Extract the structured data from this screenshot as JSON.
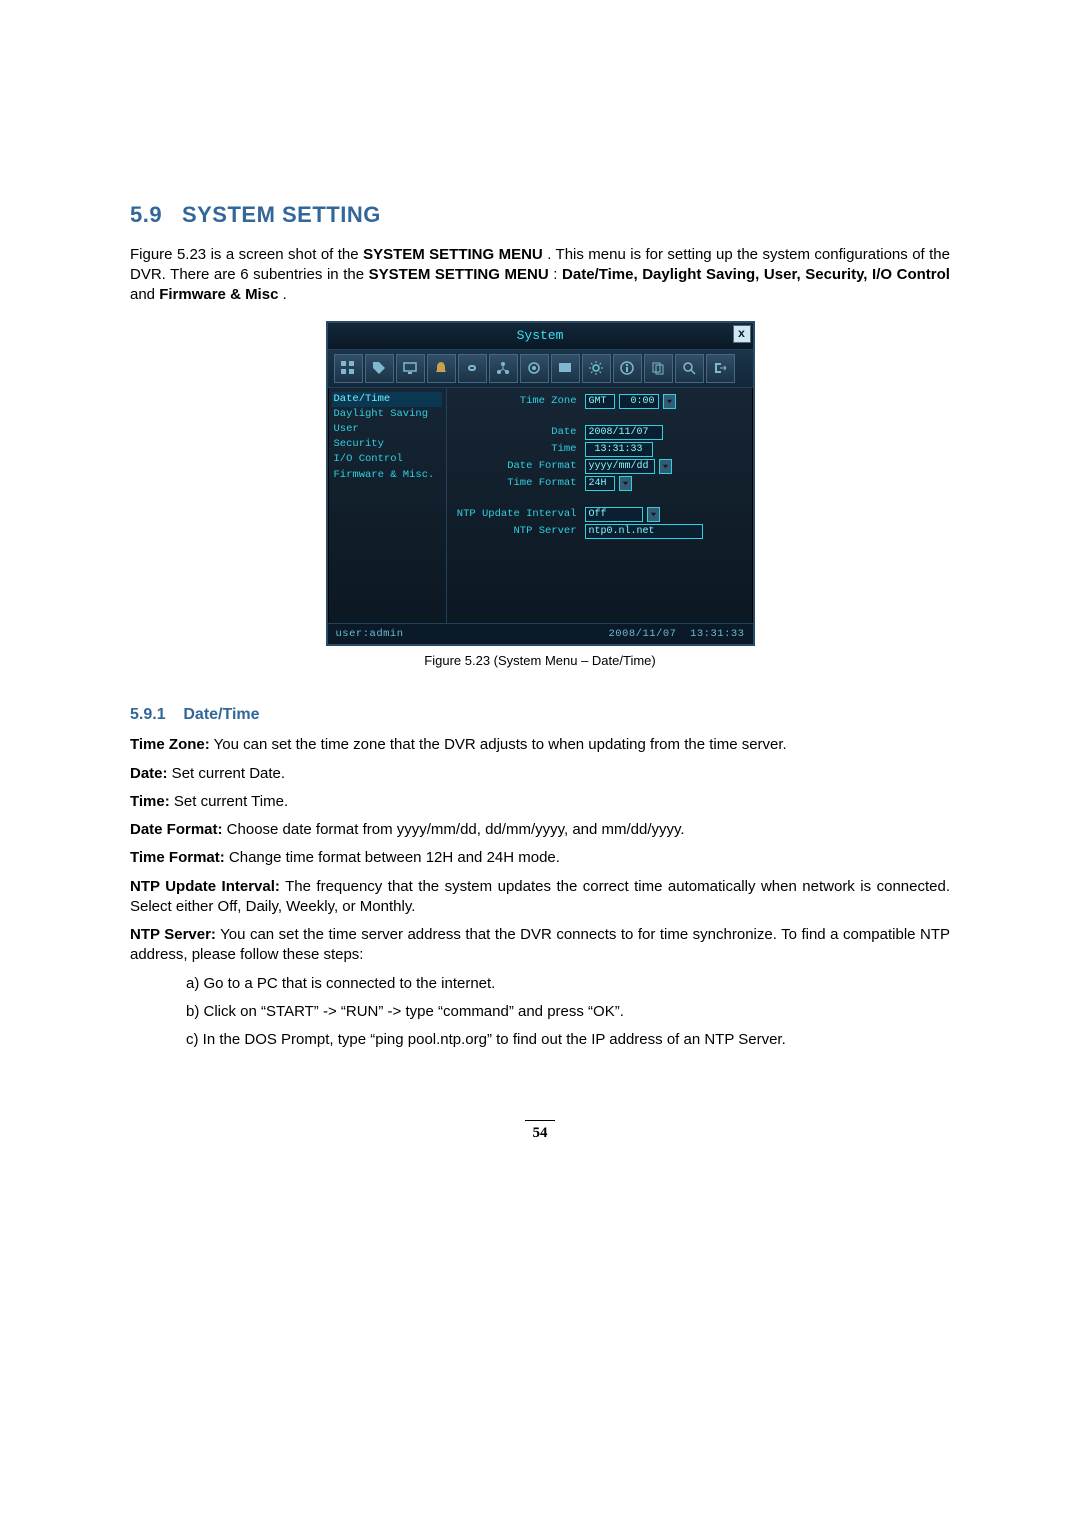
{
  "section": {
    "number": "5.9",
    "title": "SYSTEM SETTING",
    "intro_pre": "Figure 5.23 is a screen shot of the ",
    "intro_bold1": "SYSTEM SETTING MENU",
    "intro_mid1": ". This menu is for setting up the system configurations of the DVR. There are 6 subentries in the ",
    "intro_bold2": "SYSTEM SETTING MENU",
    "intro_mid2": ": ",
    "intro_bold3": "Date/Time, Daylight Saving, User, Security, I/O Control",
    "intro_mid3": " and ",
    "intro_bold4": "Firmware & Misc",
    "intro_end": "."
  },
  "figure": {
    "caption": "Figure 5.23 (System Menu – Date/Time)"
  },
  "ui": {
    "title": "System",
    "close": "x",
    "icons": [
      "grid-icon",
      "tag-icon",
      "monitor-icon",
      "bell-icon",
      "link-icon",
      "network-icon",
      "camera-icon",
      "screen-icon",
      "settings-icon",
      "info-icon",
      "copy-icon",
      "search-icon",
      "exit-icon"
    ],
    "sidebar": [
      {
        "label": "Date/Time",
        "active": true
      },
      {
        "label": "Daylight Saving"
      },
      {
        "label": "User"
      },
      {
        "label": "Security"
      },
      {
        "label": "I/O Control"
      },
      {
        "label": "Firmware & Misc."
      }
    ],
    "fields": {
      "timezone_label": "Time Zone",
      "timezone_a": "GMT",
      "timezone_b": "0:00",
      "date_label": "Date",
      "date_val": "2008/11/07",
      "time_label": "Time",
      "time_val": "13:31:33",
      "dateformat_label": "Date Format",
      "dateformat_val": "yyyy/mm/dd",
      "timeformat_label": "Time Format",
      "timeformat_val": "24H",
      "ntpint_label": "NTP Update Interval",
      "ntpint_val": "Off",
      "ntpserver_label": "NTP Server",
      "ntpserver_val": "ntp0.nl.net"
    },
    "status_user_label": "user:",
    "status_user": "admin",
    "status_date": "2008/11/07",
    "status_time": "13:31:33"
  },
  "subsection": {
    "number": "5.9.1",
    "title": "Date/Time"
  },
  "defs": {
    "tz_b": "Time Zone:",
    "tz_t": " You can set the time zone that the DVR adjusts to when updating from the time server.",
    "date_b": "Date:",
    "date_t": " Set current Date.",
    "time_b": "Time:",
    "time_t": " Set current Time.",
    "df_b": "Date Format:",
    "df_t": " Choose date format from yyyy/mm/dd, dd/mm/yyyy, and mm/dd/yyyy.",
    "tf_b": "Time Format:",
    "tf_t": " Change time format between 12H and 24H mode.",
    "ni_b": "NTP Update Interval:",
    "ni_t": " The frequency that the system updates the correct time automatically when network is connected. Select either Off, Daily, Weekly, or Monthly.",
    "ns_b": "NTP Server:",
    "ns_t": " You can set the time server address that the DVR connects to for time synchronize. To find a compatible NTP address, please follow these steps:"
  },
  "steps": {
    "a": "a) Go to a PC that is connected to the internet.",
    "b": "b) Click on “START” -> “RUN” -> type “command” and press “OK”.",
    "c": "c) In the DOS Prompt, type “ping pool.ntp.org” to find out the IP address of an NTP Server."
  },
  "page_number": "54"
}
